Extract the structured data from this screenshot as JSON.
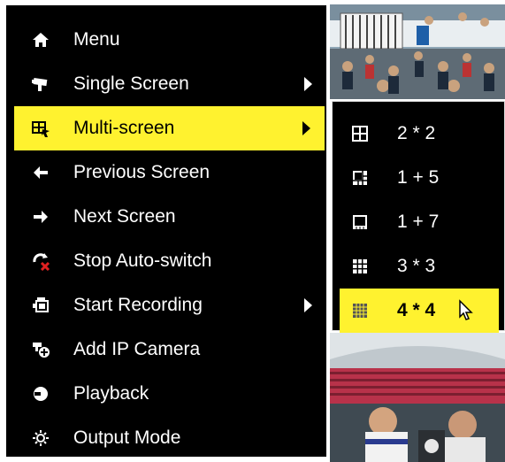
{
  "menu": {
    "items": [
      {
        "label": "Menu",
        "icon": "home-icon",
        "has_submenu": false
      },
      {
        "label": "Single Screen",
        "icon": "camera-icon",
        "has_submenu": true
      },
      {
        "label": "Multi-screen",
        "icon": "multi-screen-icon",
        "has_submenu": true,
        "active": true
      },
      {
        "label": "Previous Screen",
        "icon": "arrow-left-icon",
        "has_submenu": false
      },
      {
        "label": "Next Screen",
        "icon": "arrow-right-icon",
        "has_submenu": false
      },
      {
        "label": "Stop Auto-switch",
        "icon": "stop-switch-icon",
        "has_submenu": false
      },
      {
        "label": "Start Recording",
        "icon": "recording-icon",
        "has_submenu": true
      },
      {
        "label": "Add IP Camera",
        "icon": "add-camera-icon",
        "has_submenu": false
      },
      {
        "label": "Playback",
        "icon": "playback-icon",
        "has_submenu": false
      },
      {
        "label": "Output Mode",
        "icon": "output-mode-icon",
        "has_submenu": false
      }
    ]
  },
  "submenu": {
    "items": [
      {
        "label": "2 * 2",
        "icon": "grid-2x2-icon"
      },
      {
        "label": "1 + 5",
        "icon": "layout-1-5-icon"
      },
      {
        "label": "1 + 7",
        "icon": "layout-1-7-icon"
      },
      {
        "label": "3 * 3",
        "icon": "grid-3x3-icon"
      },
      {
        "label": "4 * 4",
        "icon": "grid-4x4-icon",
        "active": true
      }
    ]
  },
  "colors": {
    "highlight": "#fff22f",
    "menu_bg": "#000000",
    "menu_text": "#ffffff"
  }
}
